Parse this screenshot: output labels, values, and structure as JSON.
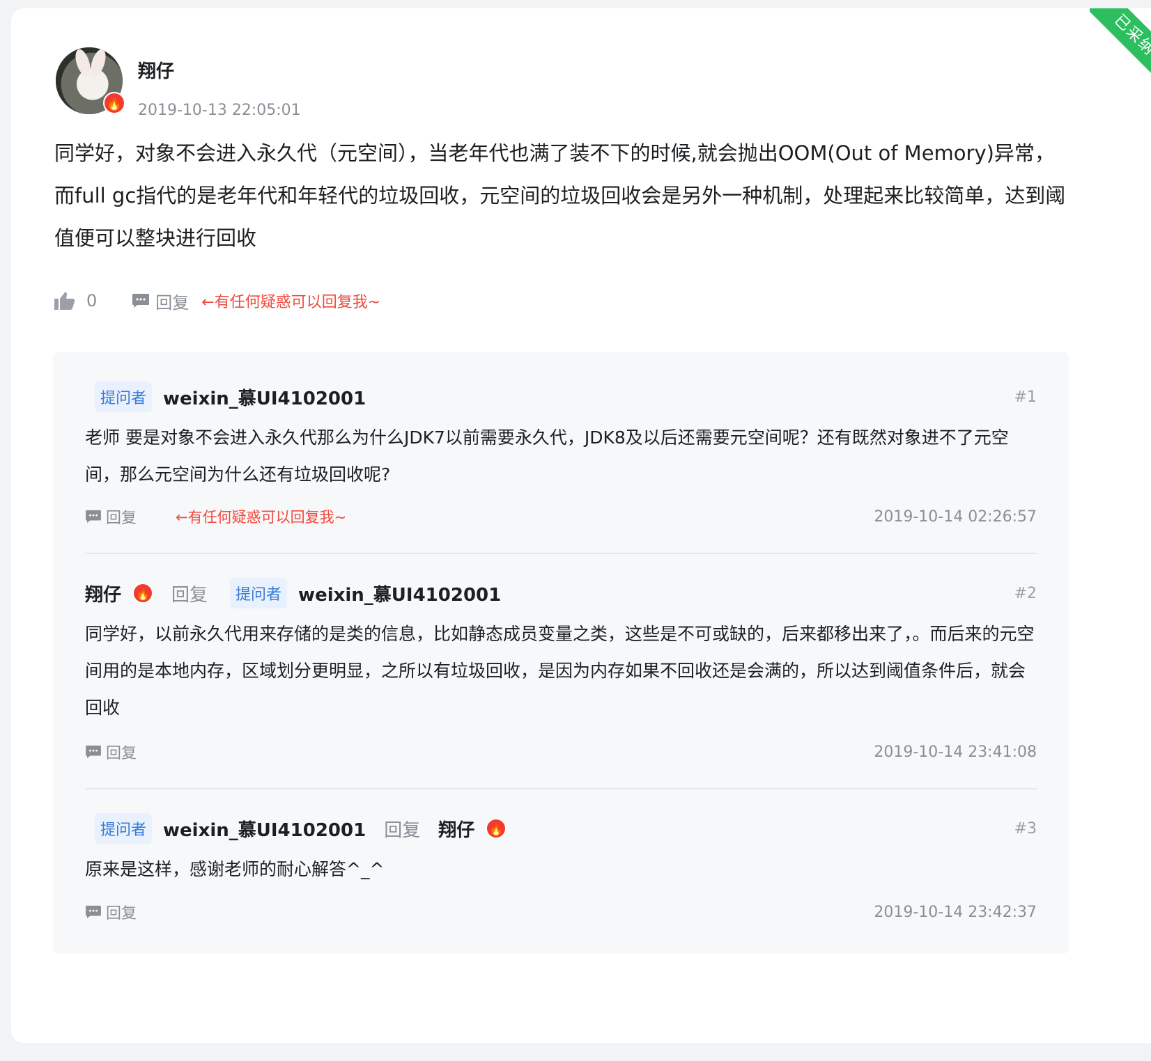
{
  "badge": {
    "label": "已采纳"
  },
  "answer": {
    "author": "翔仔",
    "time": "2019-10-13 22:05:01",
    "body": "同学好，对象不会进入永久代（元空间），当老年代也满了装不下的时候,就会抛出OOM(Out of Memory)异常，而full gc指代的是老年代和年轻代的垃圾回收，元空间的垃圾回收会是另外一种机制，处理起来比较简单，达到阈值便可以整块进行回收",
    "likes": "0",
    "reply_label": "回复",
    "hint": "←有任何疑惑可以回复我~"
  },
  "thread": [
    {
      "tag": "提问者",
      "user": "weixin_慕UI4102001",
      "num": "#1",
      "text": "老师 要是对象不会进入永久代那么为什么JDK7以前需要永久代，JDK8及以后还需要元空间呢？还有既然对象进不了元空间，那么元空间为什么还有垃圾回收呢?",
      "reply_label": "回复",
      "hint": "←有任何疑惑可以回复我~",
      "time": "2019-10-14 02:26:57"
    },
    {
      "user": "翔仔",
      "reply_word": "回复",
      "tag": "提问者",
      "to_user": "weixin_慕UI4102001",
      "num": "#2",
      "text": "同学好，以前永久代用来存储的是类的信息，比如静态成员变量之类，这些是不可或缺的，后来都移出来了，。而后来的元空间用的是本地内存，区域划分更明显，之所以有垃圾回收，是因为内存如果不回收还是会满的，所以达到阈值条件后，就会回收",
      "reply_label": "回复",
      "time": "2019-10-14 23:41:08"
    },
    {
      "tag": "提问者",
      "user": "weixin_慕UI4102001",
      "reply_word": "回复",
      "to_user": "翔仔",
      "num": "#3",
      "text": "原来是这样，感谢老师的耐心解答^_^",
      "reply_label": "回复",
      "time": "2019-10-14 23:42:37"
    }
  ]
}
